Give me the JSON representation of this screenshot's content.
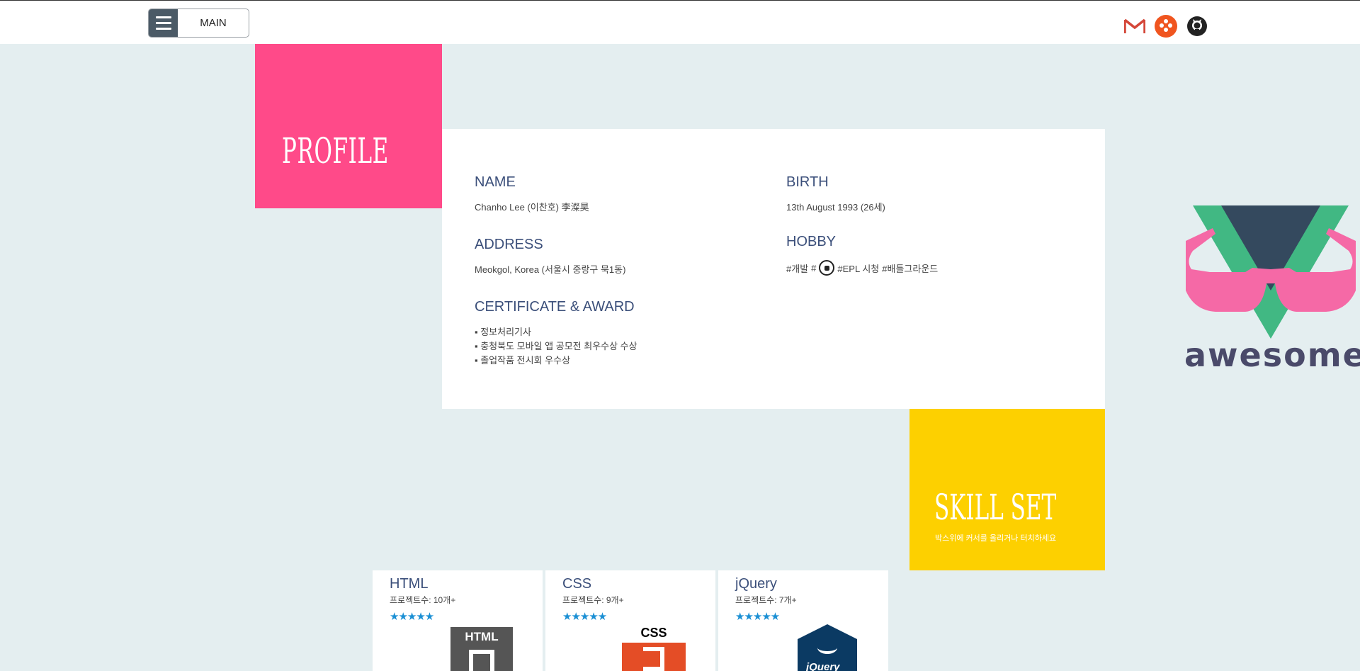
{
  "header": {
    "main_label": "MAIN",
    "menu_icon": "hamburger-menu-icon",
    "social": [
      {
        "name": "gmail-icon",
        "color": "#d44638"
      },
      {
        "name": "facebook-icon",
        "color": "#f0551f"
      },
      {
        "name": "github-icon",
        "color": "#222222"
      }
    ]
  },
  "profile": {
    "title": "PROFILE",
    "color": "#ff4a89",
    "name_label": "NAME",
    "name_value": "Chanho Lee (이찬호) 李澯昊",
    "birth_label": "BIRTH",
    "birth_value": "13th August 1993 (26세)",
    "address_label": "ADDRESS",
    "address_value": "Meokgol, Korea (서울시 중랑구 묵1동)",
    "hobby_label": "HOBBY",
    "hobby_1": "#개발",
    "hobby_2": "#",
    "hobby_3": "#EPL 시청",
    "hobby_4": "#배틀그라운드",
    "cert_label": "CERTIFICATE & AWARD",
    "cert_items": [
      "▪ 정보처리기사",
      "▪ 충청북도 모바일 앱 공모전 최우수상 수상",
      "▪ 졸업작품 전시회 우수상"
    ]
  },
  "logo": {
    "text": "awesome"
  },
  "skillset": {
    "title": "SKILL SET",
    "subtitle": "박스위에 커서를 올리거나 터치하세요",
    "color": "#fdd000",
    "skills": [
      {
        "name": "HTML",
        "count": "프로젝트수: 10개+",
        "stars": "★★★★★",
        "logo_text": "HTML"
      },
      {
        "name": "CSS",
        "count": "프로젝트수: 9개+",
        "stars": "★★★★★",
        "logo_text": "CSS"
      },
      {
        "name": "jQuery",
        "count": "프로젝트수: 7개+",
        "stars": "★★★★★",
        "logo_text": "jQuery"
      }
    ]
  }
}
